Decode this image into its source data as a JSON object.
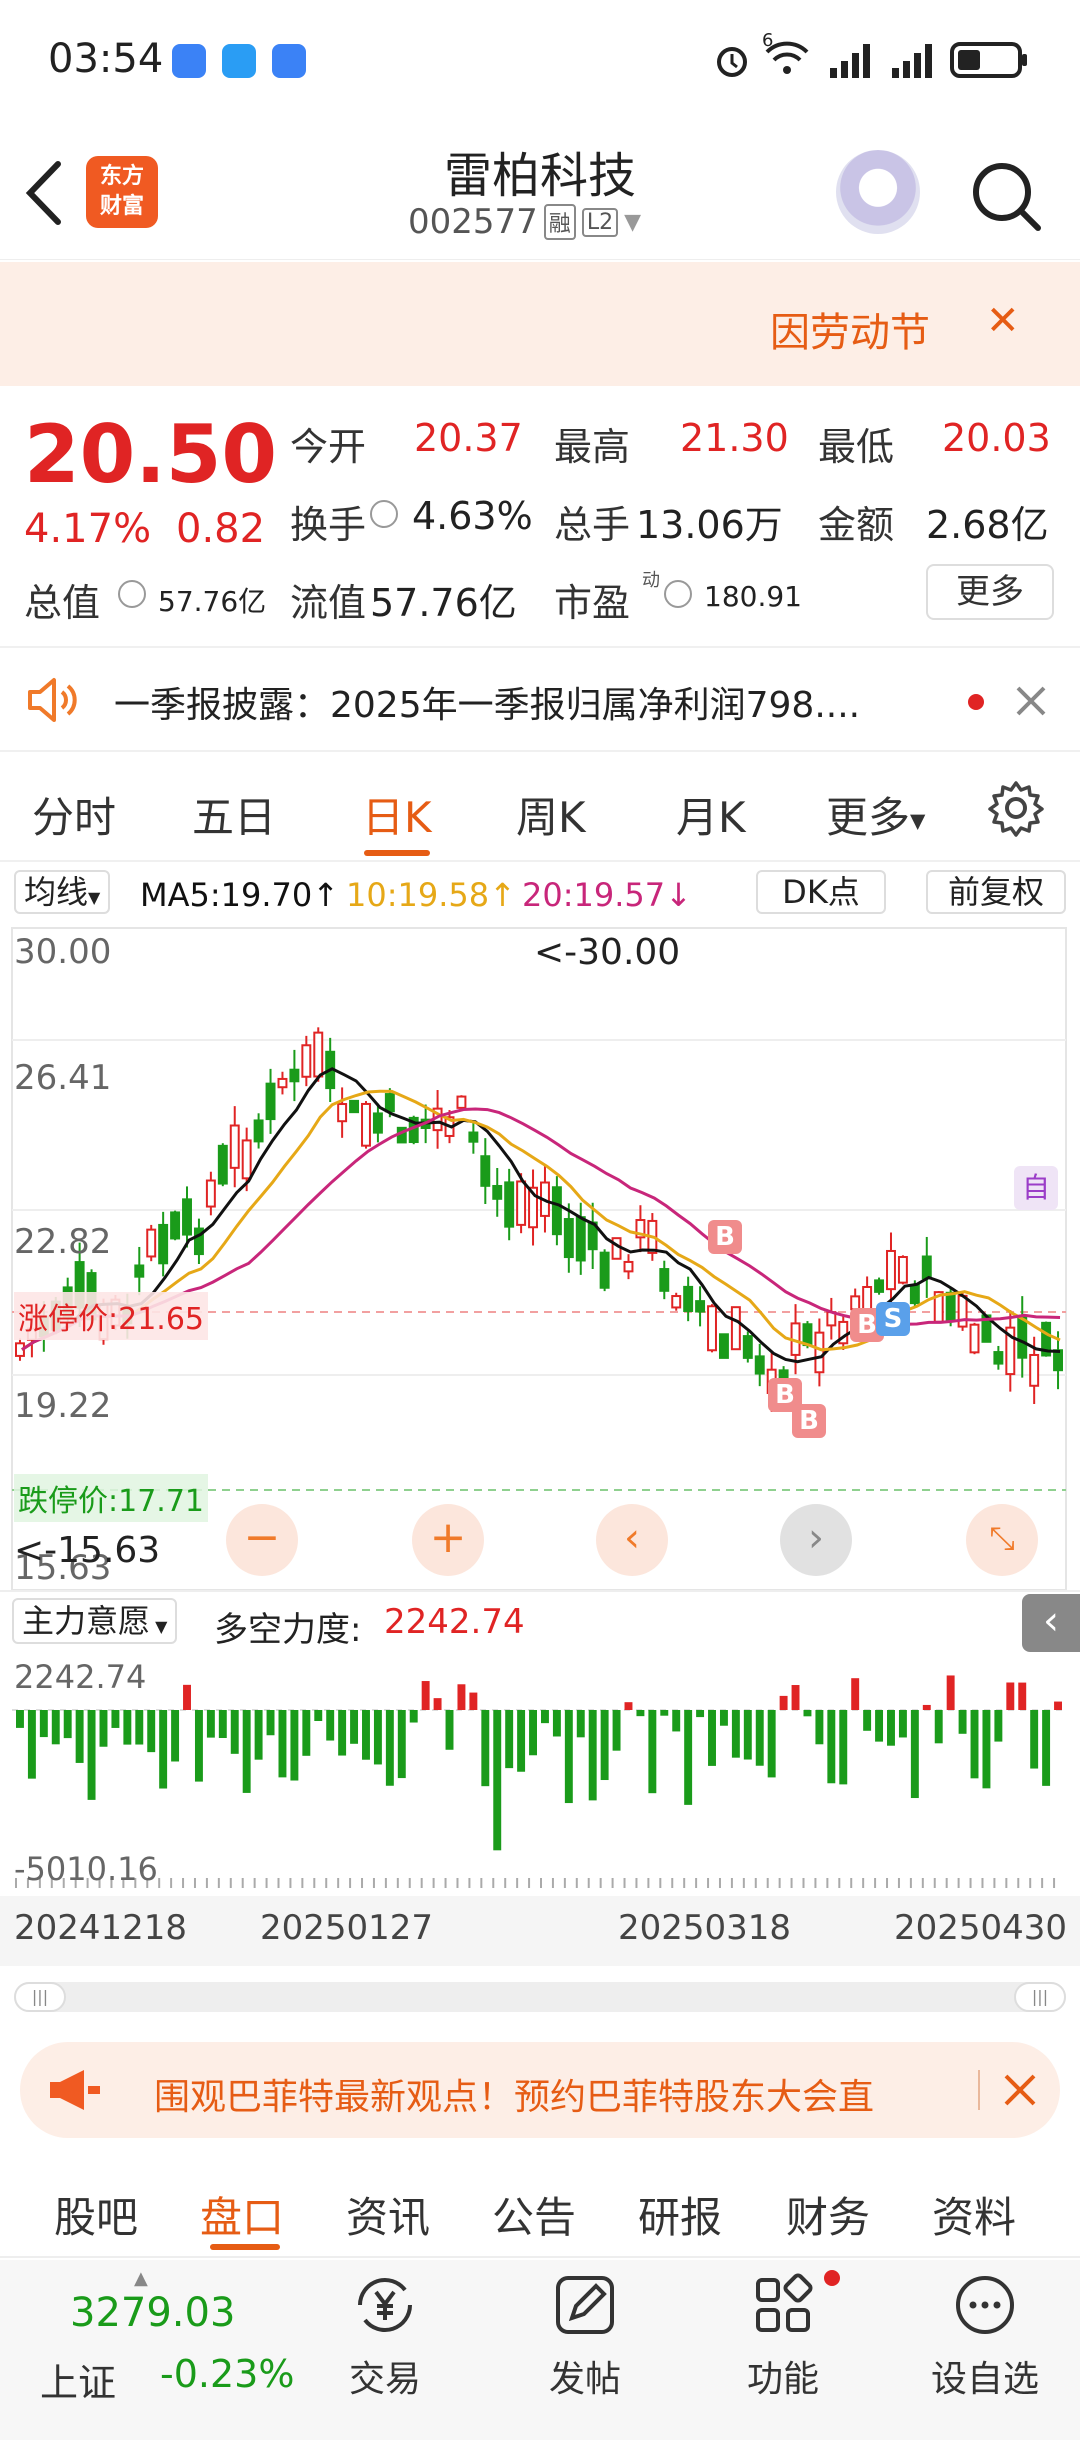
{
  "status": {
    "time": "03:54",
    "signal_badge": "6"
  },
  "header": {
    "title": "雷柏科技",
    "code": "002577",
    "badge_margin": "融",
    "badge_level": "L2"
  },
  "banner": {
    "text": "因劳动节",
    "close": "✕"
  },
  "quote": {
    "price": "20.50",
    "change_pct": "4.17%",
    "change": "0.82",
    "open_label": "今开",
    "open": "20.37",
    "high_label": "最高",
    "high": "21.30",
    "low_label": "最低",
    "low": "20.03",
    "turnover_label": "换手",
    "turnover": "4.63%",
    "volume_label": "总手",
    "volume": "13.06万",
    "amount_label": "金额",
    "amount": "2.68亿",
    "mktcap_label": "总值",
    "mktcap": "57.76亿",
    "float_label": "流值",
    "float": "57.76亿",
    "pe_label": "市盈",
    "pe_sup": "动",
    "pe": "180.91",
    "more": "更多"
  },
  "news": {
    "text": "一季报披露：2025年一季报归属净利润798...."
  },
  "tabs": [
    "分时",
    "五日",
    "日K",
    "周K",
    "月K",
    "更多"
  ],
  "active_tab": 2,
  "ma": {
    "selector": "均线",
    "ma5": "MA5:19.70↑",
    "ma10": "10:19.58↑",
    "ma20": "20:19.57↓",
    "dk": "DK点",
    "adjust": "前复权"
  },
  "kline": {
    "y_labels": [
      "30.00",
      "26.41",
      "22.82",
      "19.22",
      "15.63"
    ],
    "max_label": "<-30.00",
    "min_label": "<-15.63",
    "limit_up": "涨停价:21.65",
    "limit_down": "跌停价:17.71",
    "self_tag": "自",
    "signals": [
      "B",
      "B",
      "B",
      "B",
      "S"
    ],
    "colors": {
      "up": "#e02424",
      "down": "#1a9b1a",
      "ma5": "#111111",
      "ma10": "#e6a817",
      "ma20": "#c8267a"
    }
  },
  "indicator": {
    "selector": "主力意愿",
    "label": "多空力度:",
    "value": "2242.74",
    "top": "2242.74",
    "bottom": "-5010.16"
  },
  "dates": [
    "20241218",
    "20250127",
    "20250318",
    "20250430"
  ],
  "ad": {
    "text": "围观巴菲特最新观点！预约巴菲特股东大会直"
  },
  "bottom_tabs": [
    "股吧",
    "盘口",
    "资讯",
    "公告",
    "研报",
    "财务",
    "资料"
  ],
  "bottom_active": 1,
  "index": {
    "value": "3279.03",
    "name": "上证",
    "change": "-0.23%"
  },
  "nav": {
    "trade": "交易",
    "post": "发帖",
    "func": "功能",
    "watch": "设自选"
  }
}
